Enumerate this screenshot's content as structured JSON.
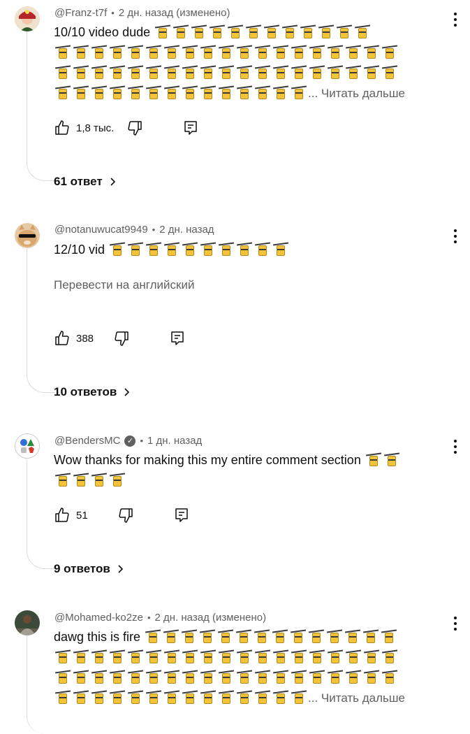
{
  "comments": [
    {
      "author": "@Franz-t7f",
      "time": "2 дн. назад (изменено)",
      "text": "10/10 video dude",
      "read_more": "... Читать дальше",
      "likes": "1,8 тыс.",
      "replies": "61 ответ"
    },
    {
      "author": "@notanuwucat9949",
      "time": "2 дн. назад",
      "text": "12/10 vid",
      "translate": "Перевести на английский",
      "likes": "388",
      "replies": "10 ответов"
    },
    {
      "author": "@BendersMC",
      "time": "1 дн. назад",
      "text": "Wow thanks for making this my entire comment section",
      "likes": "51",
      "replies": "9 ответов"
    },
    {
      "author": "@Mohamed-ko2ze",
      "time": "2 дн. назад (изменено)",
      "text": "dawg this is fire",
      "read_more": "... Читать дальше"
    }
  ],
  "emoji_icon": "aerial-tramway-icon",
  "colors": {
    "secondary_text": "#606060",
    "primary_text": "#0f0f0f",
    "thread_line": "#dcdcdc"
  }
}
